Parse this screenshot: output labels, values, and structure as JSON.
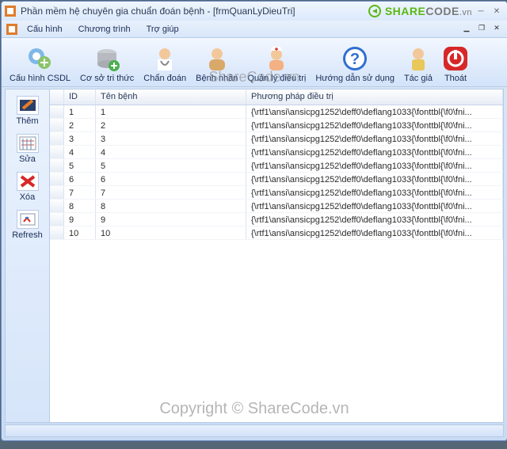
{
  "title": "Phần mềm hệ chuyên gia chuẩn đoán bệnh - [frmQuanLyDieuTri]",
  "brand": {
    "prefix": "SHARE",
    "mid": "CODE",
    "suffix": ".vn"
  },
  "menu": [
    "Cấu hình",
    "Chương trình",
    "Trợ giúp"
  ],
  "toolbar": [
    {
      "label": "Cấu hình CSDL",
      "icon": "gear-db"
    },
    {
      "label": "Cơ sở tri thức",
      "icon": "database-plus"
    },
    {
      "label": "Chẩn đoán",
      "icon": "doctor"
    },
    {
      "label": "Bệnh nhân",
      "icon": "patient"
    },
    {
      "label": "Quản lý điều trị",
      "icon": "nurse"
    },
    {
      "label": "Hướng dẫn sử dụng",
      "icon": "help"
    },
    {
      "label": "Tác giả",
      "icon": "author"
    },
    {
      "label": "Thoát",
      "icon": "power"
    }
  ],
  "sidebar": [
    {
      "label": "Thêm"
    },
    {
      "label": "Sửa"
    },
    {
      "label": "Xóa"
    },
    {
      "label": "Refresh"
    }
  ],
  "grid": {
    "columns": [
      "ID",
      "Tên bệnh",
      "Phương pháp điều trị"
    ],
    "rows": [
      {
        "id": "1",
        "name": "1",
        "method": "{\\rtf1\\ansi\\ansicpg1252\\deff0\\deflang1033{\\fonttbl{\\f0\\fni..."
      },
      {
        "id": "2",
        "name": "2",
        "method": "{\\rtf1\\ansi\\ansicpg1252\\deff0\\deflang1033{\\fonttbl{\\f0\\fni..."
      },
      {
        "id": "3",
        "name": "3",
        "method": "{\\rtf1\\ansi\\ansicpg1252\\deff0\\deflang1033{\\fonttbl{\\f0\\fni..."
      },
      {
        "id": "4",
        "name": "4",
        "method": "{\\rtf1\\ansi\\ansicpg1252\\deff0\\deflang1033{\\fonttbl{\\f0\\fni..."
      },
      {
        "id": "5",
        "name": "5",
        "method": "{\\rtf1\\ansi\\ansicpg1252\\deff0\\deflang1033{\\fonttbl{\\f0\\fni..."
      },
      {
        "id": "6",
        "name": "6",
        "method": "{\\rtf1\\ansi\\ansicpg1252\\deff0\\deflang1033{\\fonttbl{\\f0\\fni..."
      },
      {
        "id": "7",
        "name": "7",
        "method": "{\\rtf1\\ansi\\ansicpg1252\\deff0\\deflang1033{\\fonttbl{\\f0\\fni..."
      },
      {
        "id": "8",
        "name": "8",
        "method": "{\\rtf1\\ansi\\ansicpg1252\\deff0\\deflang1033{\\fonttbl{\\f0\\fni..."
      },
      {
        "id": "9",
        "name": "9",
        "method": "{\\rtf1\\ansi\\ansicpg1252\\deff0\\deflang1033{\\fonttbl{\\f0\\fni..."
      },
      {
        "id": "10",
        "name": "10",
        "method": "{\\rtf1\\ansi\\ansicpg1252\\deff0\\deflang1033{\\fonttbl{\\f0\\fni..."
      }
    ]
  },
  "watermark_top": "ShareCode.vn",
  "watermark_bottom": "Copyright © ShareCode.vn"
}
